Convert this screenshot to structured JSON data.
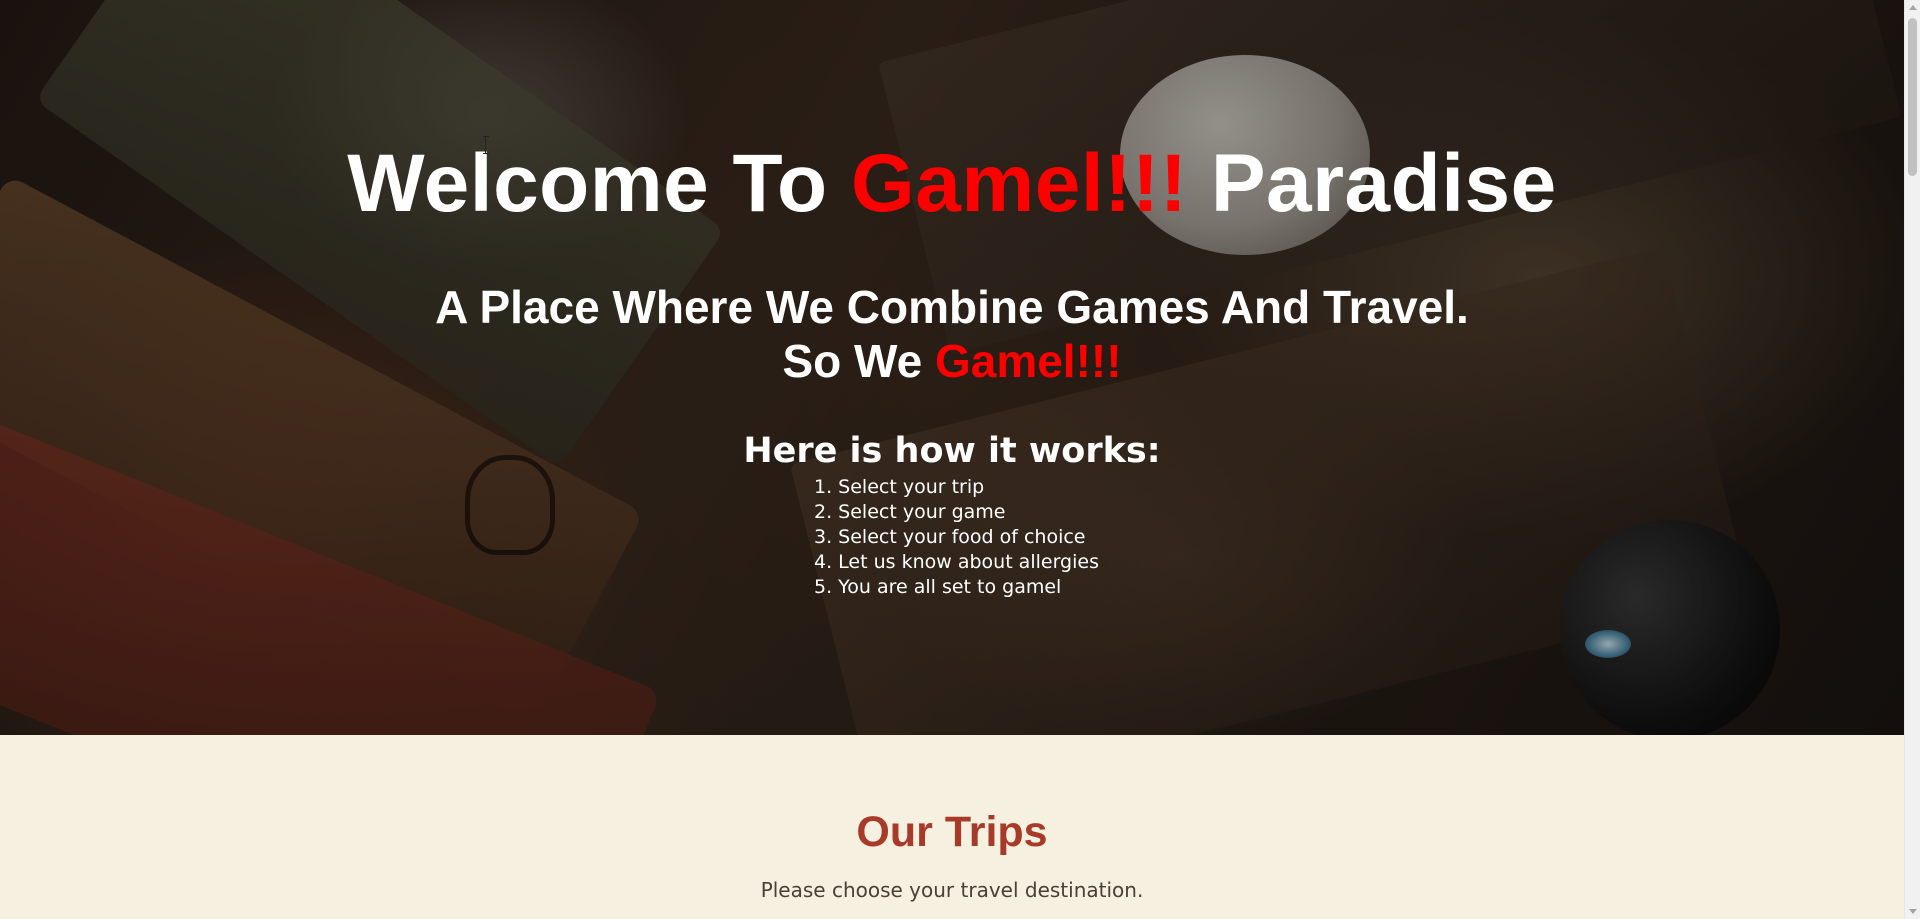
{
  "hero": {
    "title_before": "Welcome To ",
    "title_accent": "Gamel!!!",
    "title_after": " Paradise",
    "subtitle_line1": "A Place Where We Combine Games And Travel.",
    "subtitle_line2_before": "So We ",
    "subtitle_line2_accent": "Gamel!!!",
    "how_title": "Here is how it works:",
    "steps": [
      "1. Select your trip",
      "2. Select your game",
      "3. Select your food of choice",
      "4. Let us know about allergies",
      "5. You are all set to gamel"
    ]
  },
  "trips": {
    "title": "Our Trips",
    "description": "Please choose your travel destination."
  },
  "colors": {
    "accent": "#ff0000",
    "trips_title": "#a83a2a",
    "section_bg": "#f5f0df"
  },
  "icons": {
    "cursor": "text-cursor-icon",
    "scroll_up": "scroll-up-arrow-icon",
    "scroll_down": "scroll-down-arrow-icon"
  }
}
